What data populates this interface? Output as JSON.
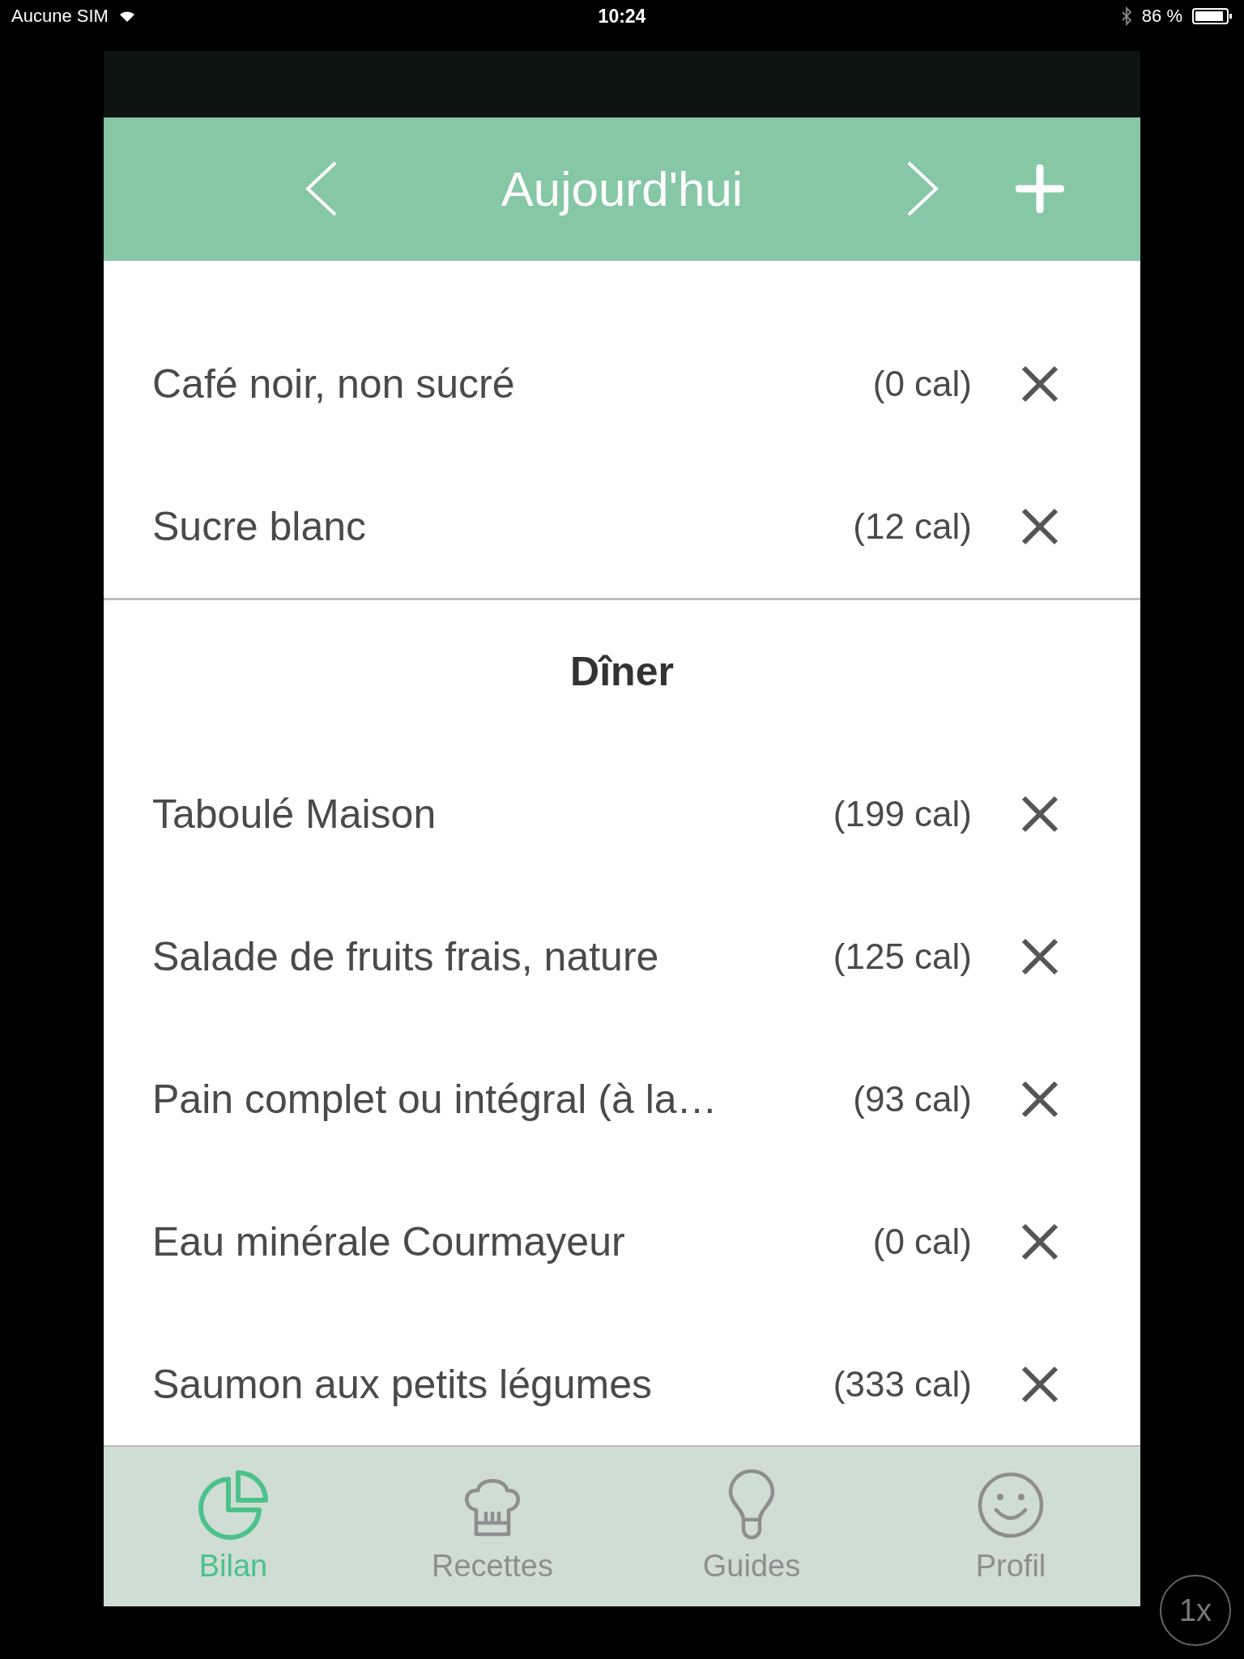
{
  "status_bar": {
    "carrier": "Aucune SIM",
    "time": "10:24",
    "battery": "86 %"
  },
  "header": {
    "title": "Aujourd'hui"
  },
  "sections": [
    {
      "items": [
        {
          "name": "Café noir, non sucré",
          "calories": "(0 cal)"
        },
        {
          "name": "Sucre blanc",
          "calories": "(12 cal)"
        }
      ]
    },
    {
      "title": "Dîner",
      "items": [
        {
          "name": "Taboulé Maison",
          "calories": "(199 cal)"
        },
        {
          "name": "Salade de fruits frais, nature",
          "calories": "(125 cal)"
        },
        {
          "name": "Pain complet ou intégral (à la…",
          "calories": "(93 cal)"
        },
        {
          "name": "Eau minérale Courmayeur",
          "calories": "(0 cal)"
        },
        {
          "name": "Saumon aux petits légumes",
          "calories": "(333 cal)"
        }
      ]
    }
  ],
  "tabs": [
    {
      "label": "Bilan",
      "kind": "chart",
      "selected": true
    },
    {
      "label": "Recettes",
      "kind": "chef",
      "selected": false
    },
    {
      "label": "Guides",
      "kind": "bulb",
      "selected": false
    },
    {
      "label": "Profil",
      "kind": "smile",
      "selected": false
    }
  ],
  "zoom_badge": "1x"
}
